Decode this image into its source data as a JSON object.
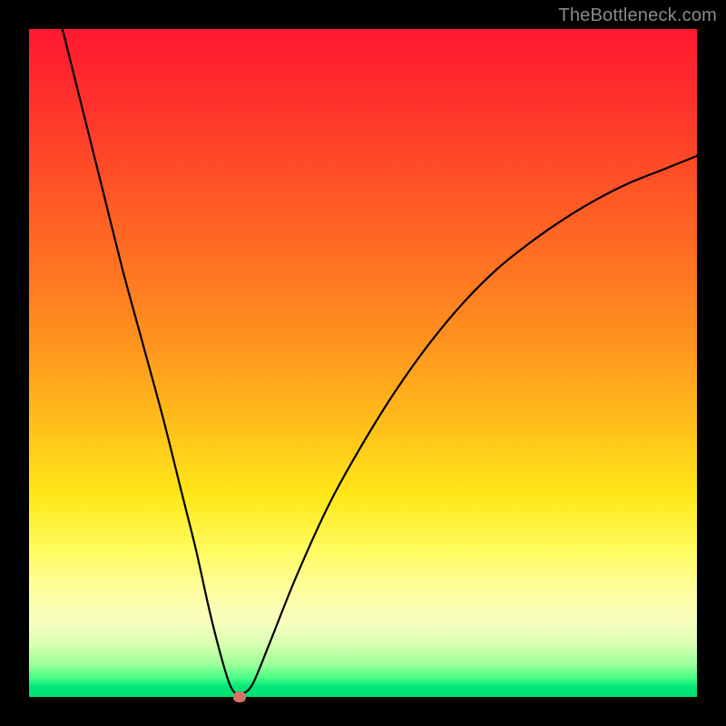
{
  "watermark": "TheBottleneck.com",
  "colors": {
    "frame": "#000000",
    "curve": "#000000",
    "marker": "#d1736a",
    "gradient_top": "#ff1930",
    "gradient_bottom": "#00e070"
  },
  "chart_data": {
    "type": "line",
    "title": "",
    "xlabel": "",
    "ylabel": "",
    "xlim": [
      0,
      100
    ],
    "ylim": [
      0,
      100
    ],
    "grid": false,
    "series": [
      {
        "name": "bottleneck-curve",
        "x": [
          5,
          8,
          11,
          14,
          17,
          20,
          23,
          25,
          27,
          28.5,
          30,
          31,
          32,
          33.5,
          36,
          40,
          45,
          50,
          55,
          60,
          65,
          70,
          75,
          80,
          85,
          90,
          95,
          100
        ],
        "y": [
          100,
          88,
          76,
          64,
          53,
          42,
          30,
          22,
          13,
          7,
          2,
          0.5,
          0.5,
          2,
          8,
          18,
          29,
          38,
          46,
          53,
          59,
          64,
          68,
          71.5,
          74.5,
          77,
          79,
          81
        ]
      }
    ],
    "marker": {
      "x": 31.5,
      "y": 0,
      "label": ""
    },
    "annotations": []
  }
}
